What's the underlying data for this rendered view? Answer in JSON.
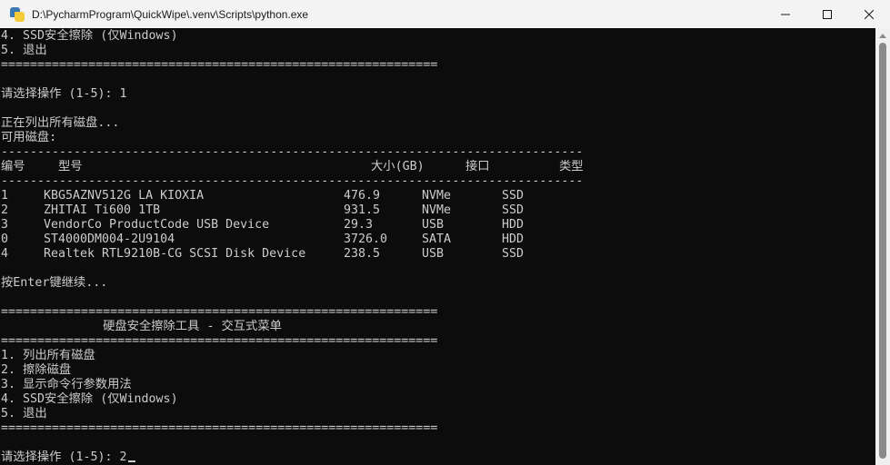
{
  "window": {
    "title": "D:\\PycharmProgram\\QuickWipe\\.venv\\Scripts\\python.exe"
  },
  "console": {
    "menu_top": {
      "item4": "4. SSD安全擦除 (仅Windows)",
      "item5": "5. 退出",
      "rule": "============================================================"
    },
    "prompt1": "请选择操作 (1-5): 1",
    "listing_status": "正在列出所有磁盘...",
    "available_disks": "可用磁盘:",
    "dash_rule": "--------------------------------------------------------------------------------",
    "table": {
      "headers": [
        "编号",
        "型号",
        "大小(GB)",
        "接口",
        "类型"
      ],
      "rows": [
        [
          "1",
          "KBG5AZNV512G LA KIOXIA",
          "476.9",
          "NVMe",
          "SSD"
        ],
        [
          "2",
          "ZHITAI Ti600 1TB",
          "931.5",
          "NVMe",
          "SSD"
        ],
        [
          "3",
          "VendorCo ProductCode USB Device",
          "29.3",
          "USB",
          "HDD"
        ],
        [
          "0",
          "ST4000DM004-2U9104",
          "3726.0",
          "SATA",
          "HDD"
        ],
        [
          "4",
          "Realtek RTL9210B-CG SCSI Disk Device",
          "238.5",
          "USB",
          "SSD"
        ]
      ]
    },
    "press_enter": "按Enter键继续...",
    "menu": {
      "rule": "============================================================",
      "title": "              硬盘安全擦除工具 - 交互式菜单",
      "items": [
        "1. 列出所有磁盘",
        "2. 擦除磁盘",
        "3. 显示命令行参数用法",
        "4. SSD安全擦除 (仅Windows)",
        "5. 退出"
      ]
    },
    "prompt2": "请选择操作 (1-5): 2"
  },
  "icons": {
    "app": "python-icon",
    "minimize": "minimize-icon",
    "maximize": "maximize-icon",
    "close": "close-icon",
    "scroll_up": "chevron-up-icon"
  },
  "colors": {
    "terminal_bg": "#0c0c0c",
    "terminal_fg": "#cccccc",
    "titlebar_bg": "#f3f3f3"
  }
}
